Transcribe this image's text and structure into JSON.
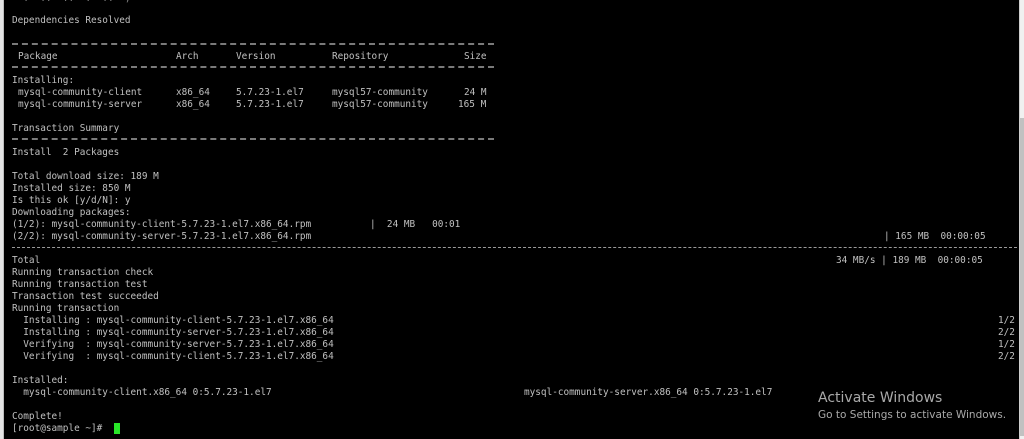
{
  "terminal": {
    "colors": {
      "background": "#000000",
      "text": "#c0c0c0",
      "cursor": "#29e629"
    },
    "top_fragment": "  .  ..  ..  .  ..  ,",
    "deps_resolved": "Dependencies Resolved",
    "table": {
      "headers": {
        "package": "Package",
        "arch": "Arch",
        "version": "Version",
        "repository": "Repository",
        "size": "Size"
      },
      "section_label": "Installing:",
      "rows": [
        {
          "package": "mysql-community-client",
          "arch": "x86_64",
          "version": "5.7.23-1.el7",
          "repository": "mysql57-community",
          "size": "24 M"
        },
        {
          "package": "mysql-community-server",
          "arch": "x86_64",
          "version": "5.7.23-1.el7",
          "repository": "mysql57-community",
          "size": "165 M"
        }
      ]
    },
    "summary_title": "Transaction Summary",
    "install_count": "Install  2 Packages",
    "total_download": "Total download size: 189 M",
    "installed_size": "Installed size: 850 M",
    "prompt_confirm": "Is this ok [y/d/N]: y",
    "downloading": "Downloading packages:",
    "downloads": [
      {
        "name": "(1/2): mysql-community-client-5.7.23-1.el7.x86_64.rpm",
        "progress": "|  24 MB   00:01"
      },
      {
        "name": "(2/2): mysql-community-server-5.7.23-1.el7.x86_64.rpm",
        "progress": "| 165 MB  00:00:05"
      }
    ],
    "total_label": "Total",
    "total_stats": "34 MB/s | 189 MB  00:00:05",
    "transaction_lines": [
      "Running transaction check",
      "Running transaction test",
      "Transaction test succeeded",
      "Running transaction"
    ],
    "steps": [
      {
        "action": "  Installing : mysql-community-client-5.7.23-1.el7.x86_64",
        "count": "1/2"
      },
      {
        "action": "  Installing : mysql-community-server-5.7.23-1.el7.x86_64",
        "count": "2/2"
      },
      {
        "action": "  Verifying  : mysql-community-server-5.7.23-1.el7.x86_64",
        "count": "1/2"
      },
      {
        "action": "  Verifying  : mysql-community-client-5.7.23-1.el7.x86_64",
        "count": "2/2"
      }
    ],
    "installed_label": "Installed:",
    "installed_pkgs": [
      "  mysql-community-client.x86_64 0:5.7.23-1.el7",
      "mysql-community-server.x86_64 0:5.7.23-1.el7"
    ],
    "complete": "Complete!",
    "shell_prompt": "[root@sample ~]# "
  },
  "watermark": {
    "title": "Activate Windows",
    "subtitle": "Go to Settings to activate Windows."
  }
}
